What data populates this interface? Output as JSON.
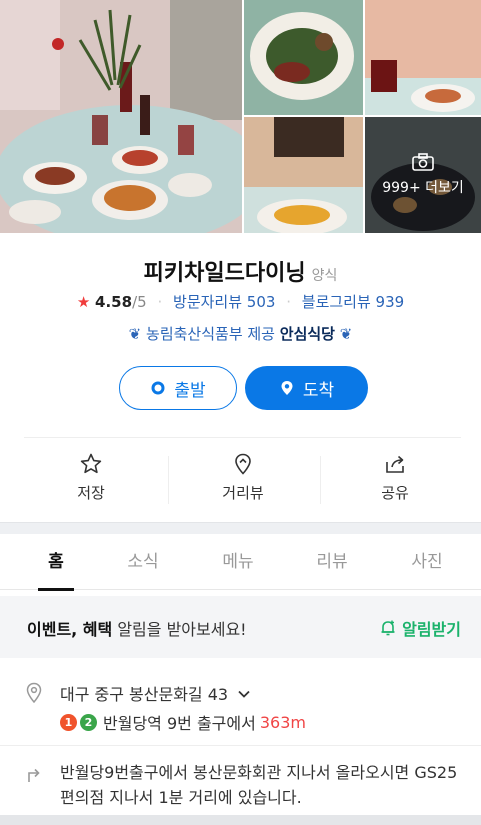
{
  "photos": {
    "more_label": "999+ 더보기"
  },
  "place": {
    "name": "피키차일드다이닝",
    "category": "양식",
    "rating": "4.58",
    "rating_max": "/5",
    "visitor_reviews": "방문자리뷰 503",
    "blog_reviews": "블로그리뷰 939",
    "cert_text": "농림축산식품부 제공",
    "cert_brand": "안심식당"
  },
  "buttons": {
    "start": "출발",
    "arrive": "도착"
  },
  "actions": {
    "save": "저장",
    "distance_view": "거리뷰",
    "share": "공유"
  },
  "tabs": [
    "홈",
    "소식",
    "메뉴",
    "리뷰",
    "사진"
  ],
  "event": {
    "bold": "이벤트, 혜택",
    "rest": " 알림을 받아보세요!",
    "alarm": "알림받기"
  },
  "address": {
    "text": "대구 중구 봉산문화길 43",
    "lines": [
      {
        "num": "1",
        "color": "#f0532c"
      },
      {
        "num": "2",
        "color": "#3aa54a"
      }
    ],
    "station": "반월당역 9번 출구에서",
    "distance": "363m"
  },
  "directions": "반월당9번출구에서 봉산문화회관 지나서 올라오시면 GS25 편의점 지나서 1분 거리에 있습니다.",
  "colors": {
    "accent": "#0a78e6",
    "green": "#1ab26b",
    "link": "#2a64b7"
  }
}
